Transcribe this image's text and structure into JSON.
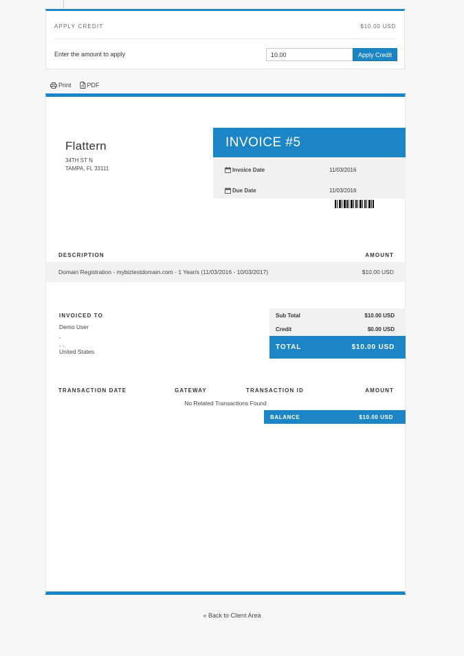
{
  "apply_credit": {
    "title": "APPLY CREDIT",
    "available": "$10.00 USD",
    "prompt": "Enter the amount to apply",
    "input_value": "10.00",
    "button_label": "Apply Credit"
  },
  "toolbar": {
    "print_label": "Print",
    "pdf_label": "PDF"
  },
  "company": {
    "name": "Flattern",
    "address_line1": "34TH ST N",
    "address_line2": "TAMPA, FL 33111"
  },
  "invoice": {
    "title": "INVOICE #5",
    "invoice_date_label": "Invoice Date",
    "invoice_date": "11/03/2016",
    "due_date_label": "Due Date",
    "due_date": "11/03/2016"
  },
  "items": {
    "description_header": "DESCRIPTION",
    "amount_header": "AMOUNT",
    "rows": [
      {
        "description": "Domain Registration - mybiztestdomain.com - 1 Year/s (11/03/2016 - 10/03/2017)",
        "amount": "$10.00 USD"
      }
    ]
  },
  "invoiced_to": {
    "label": "INVOICED TO",
    "name": "Demo User",
    "line2": ",",
    "line3": ", ,",
    "country": "United States"
  },
  "totals": {
    "subtotal_label": "Sub Total",
    "subtotal": "$10.00 USD",
    "credit_label": "Credit",
    "credit": "$0.00 USD",
    "total_label": "TOTAL",
    "total": "$10.00 USD"
  },
  "transactions": {
    "headers": [
      "TRANSACTION DATE",
      "GATEWAY",
      "TRANSACTION ID",
      "AMOUNT"
    ],
    "empty_message": "No Related Transactions Found",
    "balance_label": "BALANCE",
    "balance": "$10.00 USD"
  },
  "footer": {
    "back_link": "« Back to Client Area"
  },
  "colors": {
    "accent": "#1c85c6",
    "panel_grey": "#f1f1f2"
  }
}
